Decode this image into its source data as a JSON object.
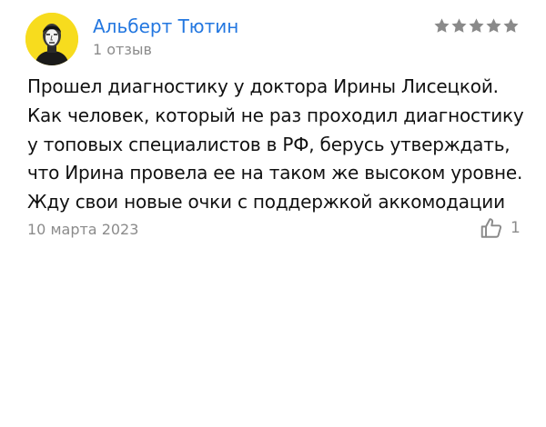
{
  "review": {
    "author": {
      "name": "Альберт Тютин",
      "reviews_count": "1 отзыв",
      "avatar_color": "#f7dc1e"
    },
    "rating": {
      "value": 5,
      "max": 5,
      "star_color": "#8a8a8a"
    },
    "text": "Прошел диагностику у доктора Ирины Лисецкой.\nКак человек, который не раз проходил диагностику\nу топовых специалистов в РФ, берусь утверждать,\nчто Ирина провела ее на таком же высоком уровне.\nЖду свои новые очки с поддержкой аккомодации",
    "date": "10 марта 2023",
    "likes": {
      "icon": "thumbs-up-icon",
      "count": "1"
    }
  },
  "colors": {
    "link": "#2377e0",
    "muted": "#8b8b8b",
    "text": "#111111"
  }
}
